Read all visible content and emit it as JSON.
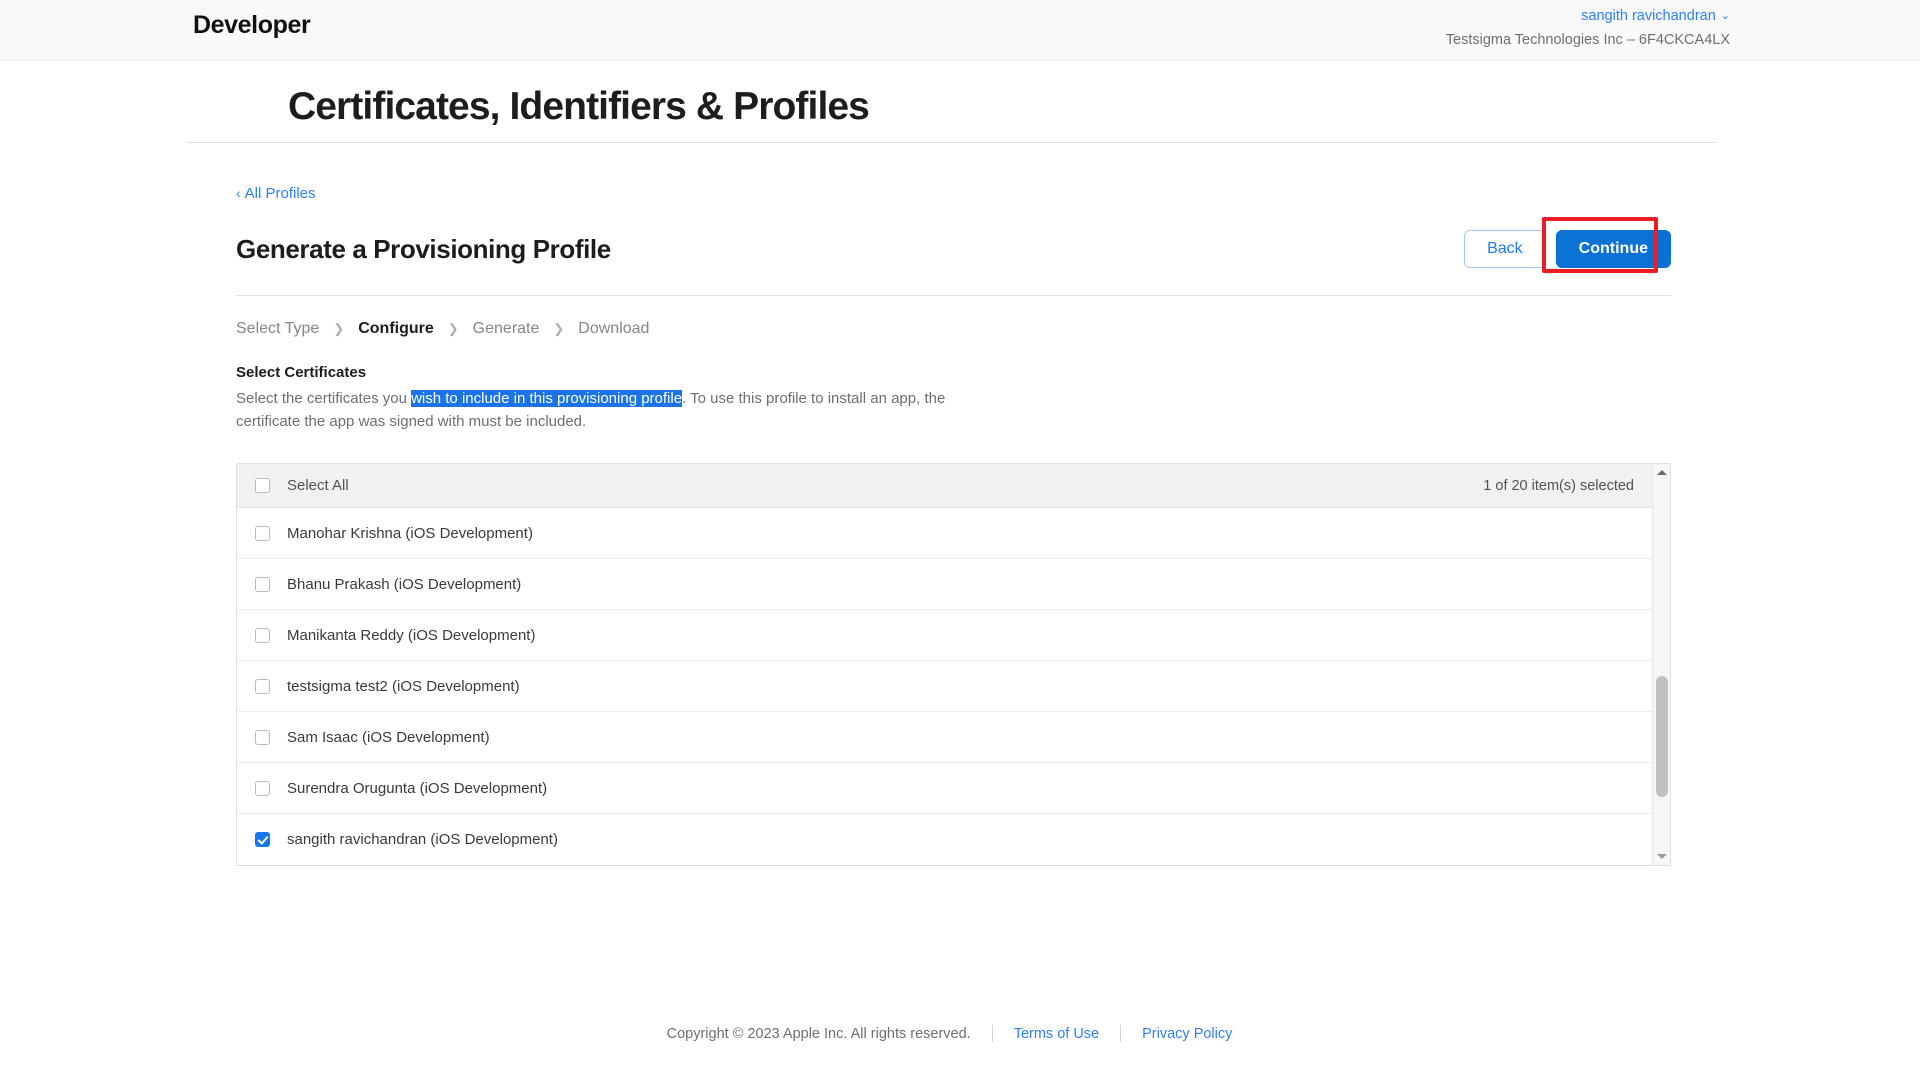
{
  "topbar": {
    "apple_glyph": "",
    "brand": "Developer",
    "account_user": "sangith ravichandran",
    "account_chevron": "⌄",
    "account_team": "Testsigma Technologies Inc – 6F4CKCA4LX"
  },
  "page": {
    "title": "Certificates, Identifiers & Profiles"
  },
  "breadcrumb": {
    "caret": "‹",
    "label": "All Profiles"
  },
  "section": {
    "title": "Generate a Provisioning Profile",
    "back_label": "Back",
    "continue_label": "Continue"
  },
  "steps": [
    {
      "label": "Select Type",
      "active": false
    },
    {
      "label": "Configure",
      "active": true
    },
    {
      "label": "Generate",
      "active": false
    },
    {
      "label": "Download",
      "active": false
    }
  ],
  "step_separator": "❯",
  "select_certificates": {
    "heading": "Select Certificates",
    "desc_before": "Select the certificates you ",
    "desc_highlight": "wish to include in this provisioning profile",
    "desc_after": ". To use this profile to install an app, the certificate the app was signed with must be included."
  },
  "list": {
    "select_all_label": "Select All",
    "select_all_checked": false,
    "count_label": "1 of 20 item(s) selected",
    "rows": [
      {
        "label": "Manohar Krishna (iOS Development)",
        "checked": false
      },
      {
        "label": "Bhanu Prakash (iOS Development)",
        "checked": false
      },
      {
        "label": "Manikanta Reddy (iOS Development)",
        "checked": false
      },
      {
        "label": "testsigma test2 (iOS Development)",
        "checked": false
      },
      {
        "label": "Sam Isaac (iOS Development)",
        "checked": false
      },
      {
        "label": "Surendra Orugunta (iOS Development)",
        "checked": false
      },
      {
        "label": "sangith ravichandran (iOS Development)",
        "checked": true
      }
    ]
  },
  "footer": {
    "copyright": "Copyright © 2023 Apple Inc. All rights reserved.",
    "terms": "Terms of Use",
    "privacy": "Privacy Policy"
  },
  "colors": {
    "accent_blue": "#0a72d4",
    "link_blue": "#2d7ff9",
    "selection_blue": "#1a73e8",
    "annotation_red": "#ef1c23"
  }
}
